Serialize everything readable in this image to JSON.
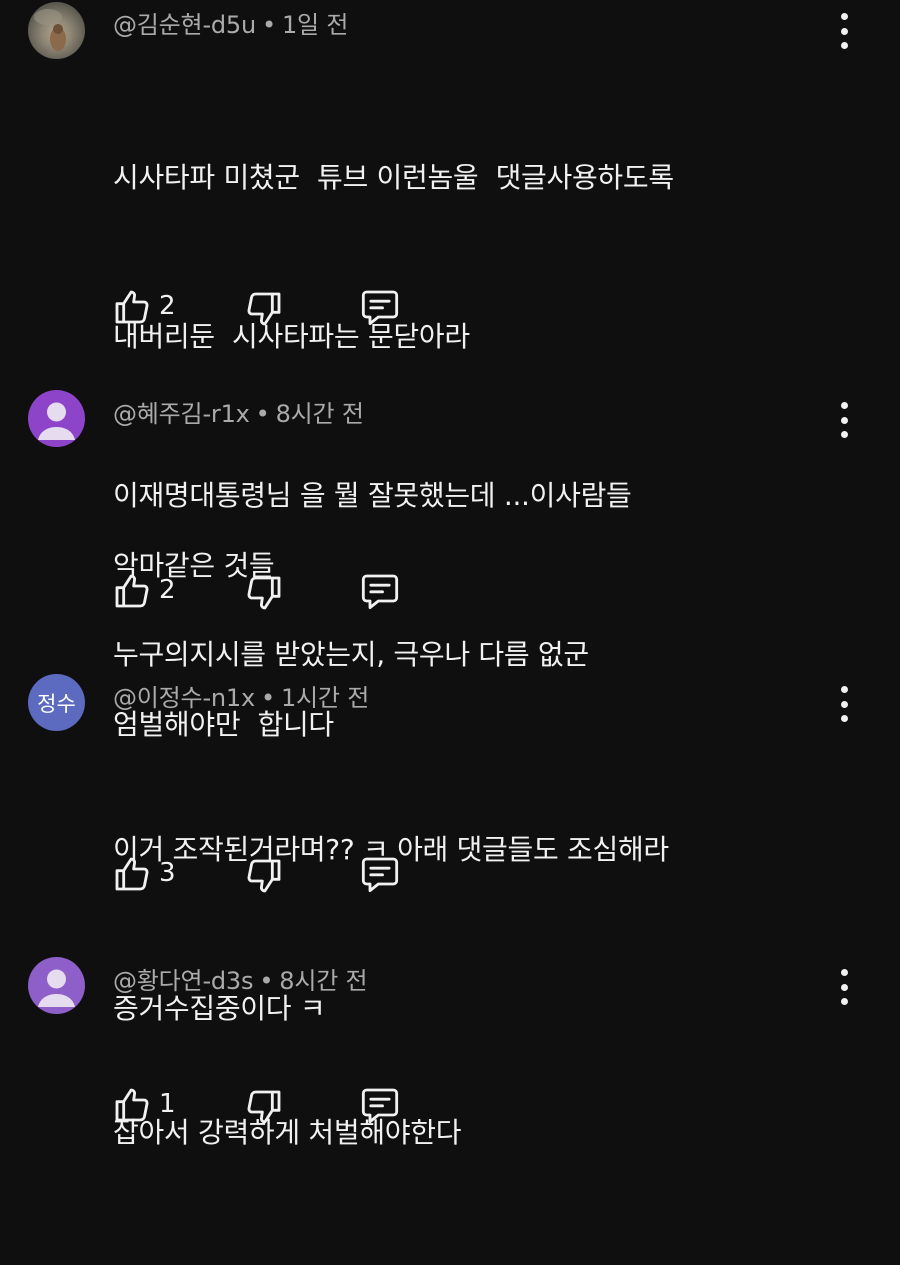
{
  "comments": [
    {
      "author": "@김순현-d5u",
      "separator": "•",
      "time": "1일 전",
      "avatar_type": "photo",
      "lines": [
        "시사타파 미쳤군  튜브 이런놈울  댓글사용하도록",
        "내버리둔  시사타파는 문닫아라",
        "이재명대통령님 을 뭘 잘못했는데 ...이사람들",
        "누구의지시를 받았는지, 극우나 다름 없군"
      ],
      "likes": "2"
    },
    {
      "author": "@혜주김-r1x",
      "separator": "•",
      "time": "8시간 전",
      "avatar_type": "person",
      "avatar_color": "#8e44c9",
      "lines": [
        "악마같은 것들",
        "엄벌해야만  합니다"
      ],
      "likes": "2"
    },
    {
      "author": "@이정수-n1x",
      "separator": "•",
      "time": "1시간 전",
      "avatar_type": "initials",
      "avatar_text": "정수",
      "avatar_color": "#5c6bc0",
      "lines": [
        "이거 조작된거라며?? ㅋ 아래 댓글들도 조심해라",
        "증거수집중이다 ㅋ"
      ],
      "likes": "3"
    },
    {
      "author": "@황다연-d3s",
      "separator": "•",
      "time": "8시간 전",
      "avatar_type": "person",
      "avatar_color": "#8e5fc9",
      "lines": [
        "잡아서 강력하게 처벌해야한다"
      ],
      "likes": "1"
    }
  ],
  "icons": {
    "like": "thumb-up-icon",
    "dislike": "thumb-down-icon",
    "reply": "reply-icon",
    "menu": "more-vert-icon"
  },
  "colors": {
    "background": "#0f0f0f",
    "text": "#f1f1f1",
    "meta": "#aaaaaa"
  }
}
